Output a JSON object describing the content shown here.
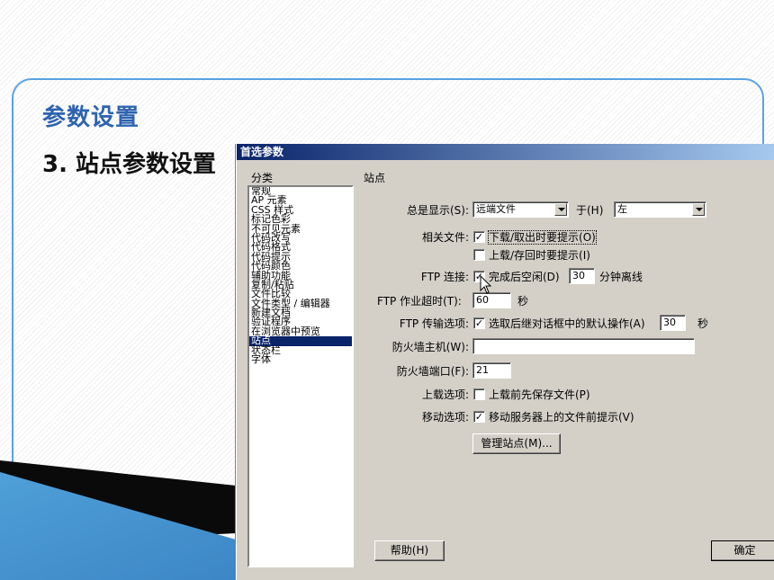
{
  "slide": {
    "heading": "参数设置",
    "subheading": "3. 站点参数设置"
  },
  "dialog": {
    "title": "首选参数",
    "category_label": "分类",
    "categories": [
      "常规",
      "AP 元素",
      "CSS 样式",
      "标记色彩",
      "不可见元素",
      "代码改写",
      "代码格式",
      "代码提示",
      "代码颜色",
      "辅助功能",
      "复制/粘贴",
      "文件比较",
      "文件类型 / 编辑器",
      "新建文档",
      "验证程序",
      "在浏览器中预览",
      "站点",
      "状态栏",
      "字体"
    ],
    "selected_category": "站点",
    "panel_title": "站点",
    "always_show": {
      "label": "总是显示(S):",
      "value": "远端文件",
      "on_label": "于(H)",
      "on_value": "左"
    },
    "related_files": {
      "label": "相关文件:",
      "download_prompt": {
        "label": "下载/取出时要提示(O)",
        "checked": true
      },
      "upload_prompt": {
        "label": "上载/存回时要提示(I)",
        "checked": false
      }
    },
    "ftp_connection": {
      "label": "FTP 连接:",
      "checkbox_label": "完成后空闲(D)",
      "checked": true,
      "minutes": "30",
      "suffix": "分钟离线"
    },
    "ftp_timeout": {
      "label": "FTP 作业超时(T):",
      "value": "60",
      "unit": "秒"
    },
    "ftp_transfer": {
      "label": "FTP 传输选项:",
      "checkbox_label": "选取后继对话框中的默认操作(A)",
      "checked": true,
      "value": "30",
      "unit": "秒"
    },
    "firewall_host": {
      "label": "防火墙主机(W):",
      "value": ""
    },
    "firewall_port": {
      "label": "防火墙端口(F):",
      "value": "21"
    },
    "upload_options": {
      "label": "上载选项:",
      "checkbox_label": "上载前先保存文件(P)",
      "checked": false
    },
    "move_options": {
      "label": "移动选项:",
      "checkbox_label": "移动服务器上的文件前提示(V)",
      "checked": true
    },
    "manage_sites_button": "管理站点(M)...",
    "help_button": "帮助(H)",
    "ok_button": "确定"
  },
  "colors": {
    "accent_blue": "#2e63b0",
    "frame_blue": "#5aa2e2",
    "dialog_face": "#d4d0c8",
    "selection": "#0a246a"
  }
}
